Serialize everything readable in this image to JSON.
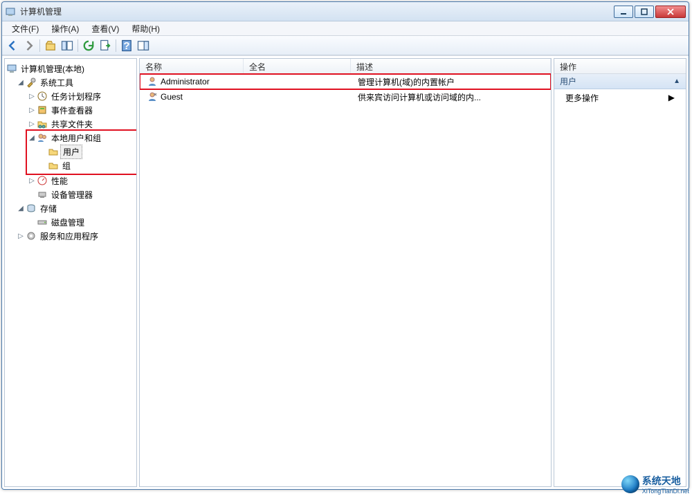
{
  "window": {
    "title": "计算机管理"
  },
  "menu": {
    "file": "文件(F)",
    "action": "操作(A)",
    "view": "查看(V)",
    "help": "帮助(H)"
  },
  "tree": {
    "root": "计算机管理(本地)",
    "system_tools": "系统工具",
    "task_scheduler": "任务计划程序",
    "event_viewer": "事件查看器",
    "shared_folders": "共享文件夹",
    "local_users_groups": "本地用户和组",
    "users": "用户",
    "groups": "组",
    "performance": "性能",
    "device_manager": "设备管理器",
    "storage": "存储",
    "disk_management": "磁盘管理",
    "services_apps": "服务和应用程序"
  },
  "columns": {
    "name": "名称",
    "fullname": "全名",
    "description": "描述"
  },
  "users": [
    {
      "name": "Administrator",
      "fullname": "",
      "description": "管理计算机(域)的内置帐户"
    },
    {
      "name": "Guest",
      "fullname": "",
      "description": "供来宾访问计算机或访问域的内..."
    }
  ],
  "actions": {
    "header": "操作",
    "group": "用户",
    "more": "更多操作"
  },
  "watermark": {
    "line1": "系统天地",
    "line2": "XiTongTianDi.net"
  }
}
